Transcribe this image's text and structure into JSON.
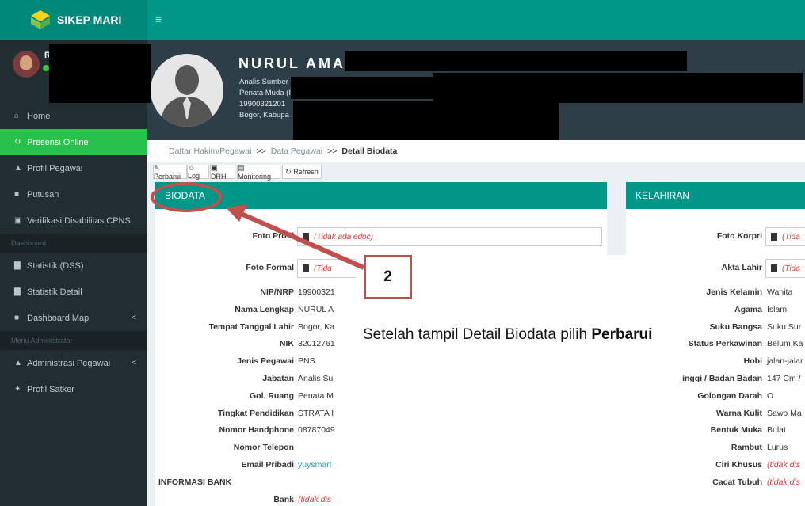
{
  "app": {
    "brand": "SIKEP MARI",
    "menu_icon": "≡"
  },
  "user": {
    "initial": "R"
  },
  "sidebar": {
    "items": [
      {
        "icon": "⌂",
        "label": "Home"
      },
      {
        "icon": "↻",
        "label": "Presensi Online",
        "active": true
      },
      {
        "icon": "▲",
        "label": "Profil Pegawai"
      },
      {
        "icon": "■",
        "label": "Putusan"
      },
      {
        "icon": "▣",
        "label": "Verifikasi Disabilitas CPNS"
      }
    ],
    "header_dashboard": "Dashboard",
    "dashboard_items": [
      {
        "icon": "▇",
        "label": "Statistik (DSS)"
      },
      {
        "icon": "▇",
        "label": "Statistik Detail"
      },
      {
        "icon": "■",
        "label": "Dashboard Map",
        "caret": "<"
      }
    ],
    "header_admin": "Menu Administrator",
    "admin_items": [
      {
        "icon": "▲",
        "label": "Administrasi Pegawai",
        "caret": "<"
      },
      {
        "icon": "✦",
        "label": "Profil Satker"
      }
    ]
  },
  "profile": {
    "name": "NURUL AMA",
    "line1": "Analis Sumber Daya Manusia Aparatur, Sub. Bagi",
    "line2": "Penata Muda (III/a)",
    "line3": "19900321201",
    "line4": "Bogor, Kabupa"
  },
  "breadcrumb": {
    "item1": "Daftar Hakim/Pegawai",
    "sep": ">>",
    "item2": "Data Pegawai",
    "current": "Detail Biodata"
  },
  "toolbar": {
    "perbarui": "✎ Perbarui",
    "log": "☺ Log",
    "drh": "▣ DRH",
    "monitoring": "▤ Monitoring",
    "refresh": "↻ Refresh"
  },
  "biodata": {
    "title": "BIODATA",
    "foto_profil_label": "Foto Profil",
    "foto_profil_value": "(Tidak ada edoc)",
    "foto_formal_label": "Foto Formal",
    "foto_formal_value": "(Tida",
    "rows": [
      {
        "label": "NIP/NRP",
        "value": "19900321"
      },
      {
        "label": "Nama Lengkap",
        "value": "NURUL A"
      },
      {
        "label": "Tempat Tanggal Lahir",
        "value": "Bogor, Ka"
      },
      {
        "label": "NIK",
        "value": "32012761"
      },
      {
        "label": "Jenis Pegawai",
        "value": "PNS"
      },
      {
        "label": "Jabatan",
        "value": "Analis Su"
      },
      {
        "label": "Gol. Ruang",
        "value": "Penata M"
      },
      {
        "label": "Tingkat Pendidikan",
        "value": "STRATA I"
      },
      {
        "label": "Nomor Handphone",
        "value": "08787049"
      },
      {
        "label": "Nomor Telepon",
        "value": ""
      },
      {
        "label": "Email Pribadi",
        "value": "yuysmart"
      }
    ],
    "bank_section": "INFORMASI BANK",
    "bank_label": "Bank",
    "bank_value": "(tidak dis"
  },
  "kelahiran": {
    "title": "KELAHIRAN",
    "foto_korpri_label": "Foto Korpri",
    "foto_korpri_value": "(Tida",
    "akta_label": "Akta Lahir",
    "akta_value": "(Tida",
    "rows": [
      {
        "label": "Jenis Kelamin",
        "value": "Wanita"
      },
      {
        "label": "Agama",
        "value": "Islam"
      },
      {
        "label": "Suku Bangsa",
        "value": "Suku Sur"
      },
      {
        "label": "Status Perkawinan",
        "value": "Belum Ka"
      },
      {
        "label": "Hobi",
        "value": "jalan-jalar"
      },
      {
        "label": "inggi / Badan Badan",
        "value": "147 Cm /"
      },
      {
        "label": "Golongan Darah",
        "value": "O"
      },
      {
        "label": "Warna Kulit",
        "value": "Sawo Ma"
      },
      {
        "label": "Bentuk Muka",
        "value": "Bulat"
      },
      {
        "label": "Rambut",
        "value": "Lurus"
      },
      {
        "label": "Ciri Khusus",
        "value": "(tidak dis"
      },
      {
        "label": "Cacat Tubuh",
        "value": "(tidak dis"
      }
    ]
  },
  "annotation": {
    "number": "2",
    "text_plain": "Setelah tampil Detail Biodata pilih ",
    "text_bold": "Perbarui"
  },
  "colors": {
    "teal": "#009688",
    "active_green": "#27c24c",
    "annotation_red": "#c0504d"
  }
}
